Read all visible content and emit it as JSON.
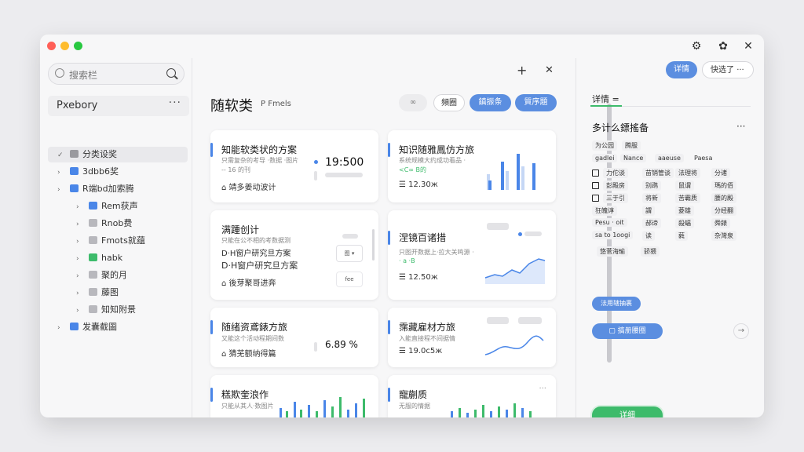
{
  "window": {
    "titlebar_icons": [
      "settings-icon",
      "gear-icon",
      "close-icon"
    ]
  },
  "sidebar": {
    "search_placeholder": "搜索栏",
    "workspace": "Pxebory",
    "workspace_more": "···",
    "tree": [
      {
        "label": "分类设奖",
        "arrow": "✓",
        "color": "#9a9a9f",
        "indent": 0
      },
      {
        "label": "3dbb6奖",
        "arrow": "›",
        "color": "#4a86e8",
        "indent": 0
      },
      {
        "label": "R端bd加索腾",
        "arrow": "›",
        "color": "#4a86e8",
        "indent": 0
      },
      {
        "label": "Rem获声",
        "arrow": "›",
        "color": "#4a86e8",
        "indent": 1
      },
      {
        "label": "Rnob费",
        "arrow": "›",
        "color": "#b8b8bd",
        "indent": 1
      },
      {
        "label": "Fmots就蕴",
        "arrow": "›",
        "color": "#b8b8bd",
        "indent": 1
      },
      {
        "label": "habk",
        "arrow": "›",
        "color": "#3dbb6b",
        "indent": 1
      },
      {
        "label": "聚的月",
        "arrow": "›",
        "color": "#b8b8bd",
        "indent": 1
      },
      {
        "label": "藤图",
        "arrow": "›",
        "color": "#b8b8bd",
        "indent": 1
      },
      {
        "label": "知知附景",
        "arrow": "›",
        "color": "#b8b8bd",
        "indent": 1
      },
      {
        "label": "发囊截圖",
        "arrow": "›",
        "color": "#4a86e8",
        "indent": 0
      }
    ]
  },
  "main": {
    "title": "随软类",
    "subtitle": "P Fmels",
    "top_add": "+",
    "top_pin": "✕",
    "filter_dots": "∞",
    "btn_view": "頻圈",
    "btn_export": "鎮振条",
    "btn_new": "質序題",
    "cards": [
      {
        "title": "知能软类状的方案",
        "desc": "只需复杂的考导 ·数据 ·图片",
        "sub": "-- 16 的刊",
        "foot": "靖多姜动波计",
        "value": "19:500",
        "chart": "none"
      },
      {
        "title": "知识随雅鳳仿方旅",
        "desc": "系统规模大约成功看品 ·",
        "sub": "<C∞ B的",
        "foot": "12.30ж",
        "value": "",
        "chart": "bar"
      },
      {
        "title": "满踵创计",
        "desc": "只能在公不相的考数据测",
        "sub": "D·H窗户研究旦方案",
        "foot": "後芽聚哥进奔",
        "value": "",
        "chart": "none"
      },
      {
        "title": "涅镜百诸措",
        "desc": "只图开数据上·拉大关鸣源 ·",
        "sub": "· a ·B",
        "foot": "12.50ж",
        "value": "",
        "chart": "area"
      },
      {
        "title": "随绪资鳶錶方旅",
        "desc": "又能这个活动程期间数",
        "sub": "",
        "foot": "猜芜额纳得篇",
        "value": "6.89 %",
        "chart": "none"
      },
      {
        "title": "霈藏雇材方旅",
        "desc": "入能直接程不间据情",
        "sub": "",
        "foot": "19.0ᴄ5ж",
        "value": "",
        "chart": "area"
      },
      {
        "title": "糕欺奎浪作",
        "desc": "只能从其人·数图片",
        "sub": "",
        "foot": "",
        "value": "",
        "chart": "bar2"
      },
      {
        "title": "寵蒯质",
        "desc": "无服的情据",
        "sub": "",
        "foot": "",
        "value": "",
        "chart": "bar2"
      }
    ],
    "card3_tag": "图 ▾",
    "card3_foot_badge": "fee"
  },
  "detail": {
    "btn_detail": "详情",
    "btn_detail2": "快选了",
    "btn_more": "···",
    "tab_label": "详情 =",
    "heading": "多计么鏢搖备",
    "heading_more": "···",
    "tags_row1": [
      "为公园",
      "腾服"
    ],
    "tags_row2": [
      "gadlei",
      "Nance",
      "ааеuse",
      "Paesa"
    ],
    "list": [
      {
        "chk": true,
        "a": "力佗谈",
        "b": "苗销管谈",
        "c": "法理将",
        "d": "分诸"
      },
      {
        "chk": true,
        "a": "彭殿房",
        "b": "别鹉",
        "c": "鼠谓",
        "d": "瑪的佰"
      },
      {
        "chk": true,
        "a": "三于引",
        "b": "将新",
        "c": "苦霸质",
        "d": "腰的殿"
      },
      {
        "chk": false,
        "a": "狂魄谆",
        "b": "謂",
        "c": "菱雄",
        "d": "分经翻"
      },
      {
        "chk": false,
        "a": "Pesu · oit",
        "b": "郝谛",
        "c": "殺蝠",
        "d": "舜錶"
      },
      {
        "chk": false,
        "a": "sa to 1oogi",
        "b": "读",
        "c": "蕤",
        "d": "杂灣泉"
      }
    ],
    "tags_end": [
      "悠菅海瑜",
      "骄猥"
    ],
    "btn_add": "法用辖抽裹",
    "btn_save": "搞册腰圈",
    "btn_ok": "详细"
  },
  "colors": {
    "accent": "#5b8ee0",
    "green": "#3dbb6b"
  }
}
